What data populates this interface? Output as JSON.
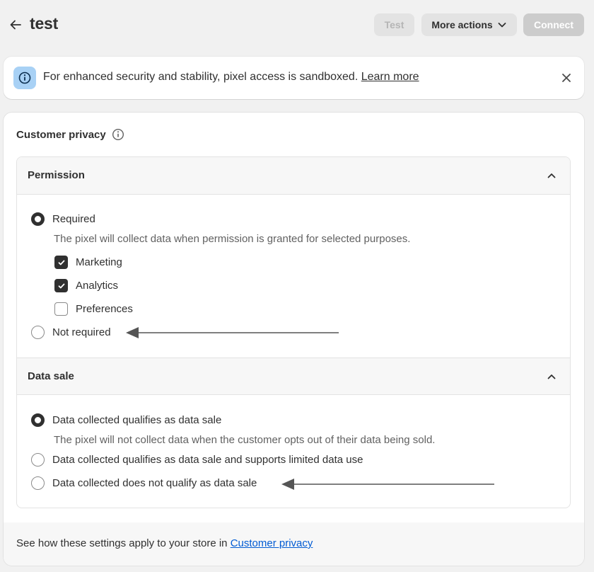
{
  "header": {
    "title": "test",
    "test_label": "Test",
    "more_actions_label": "More actions",
    "connect_label": "Connect"
  },
  "banner": {
    "message": "For enhanced security and stability, pixel access is sandboxed.",
    "link": "Learn more"
  },
  "privacy": {
    "title": "Customer privacy",
    "permission": {
      "heading": "Permission",
      "required_label": "Required",
      "required_help": "The pixel will collect data when permission is granted for selected purposes.",
      "purposes": [
        {
          "label": "Marketing",
          "checked": true
        },
        {
          "label": "Analytics",
          "checked": true
        },
        {
          "label": "Preferences",
          "checked": false
        }
      ],
      "not_required_label": "Not required",
      "selected": "Required"
    },
    "data_sale": {
      "heading": "Data sale",
      "options": [
        {
          "label": "Data collected qualifies as data sale",
          "selected": true
        },
        {
          "label": "Data collected qualifies as data sale and supports limited data use",
          "selected": false
        },
        {
          "label": "Data collected does not qualify as data sale",
          "selected": false
        }
      ],
      "help": "The pixel will not collect data when the customer opts out of their data being sold."
    }
  },
  "footer": {
    "text": "See how these settings apply to your store in",
    "link": "Customer privacy"
  },
  "icons": [
    "arrow-left-icon",
    "chevron-down-icon",
    "info-icon",
    "close-icon",
    "chevron-up-icon",
    "checkmark-icon",
    "annotation-arrow"
  ],
  "colors": {
    "page_bg": "#f1f1f1",
    "banner_icon_bg": "#a8d1f5",
    "link_blue": "#005bd3",
    "text": "#303030",
    "muted_text": "#616161"
  }
}
